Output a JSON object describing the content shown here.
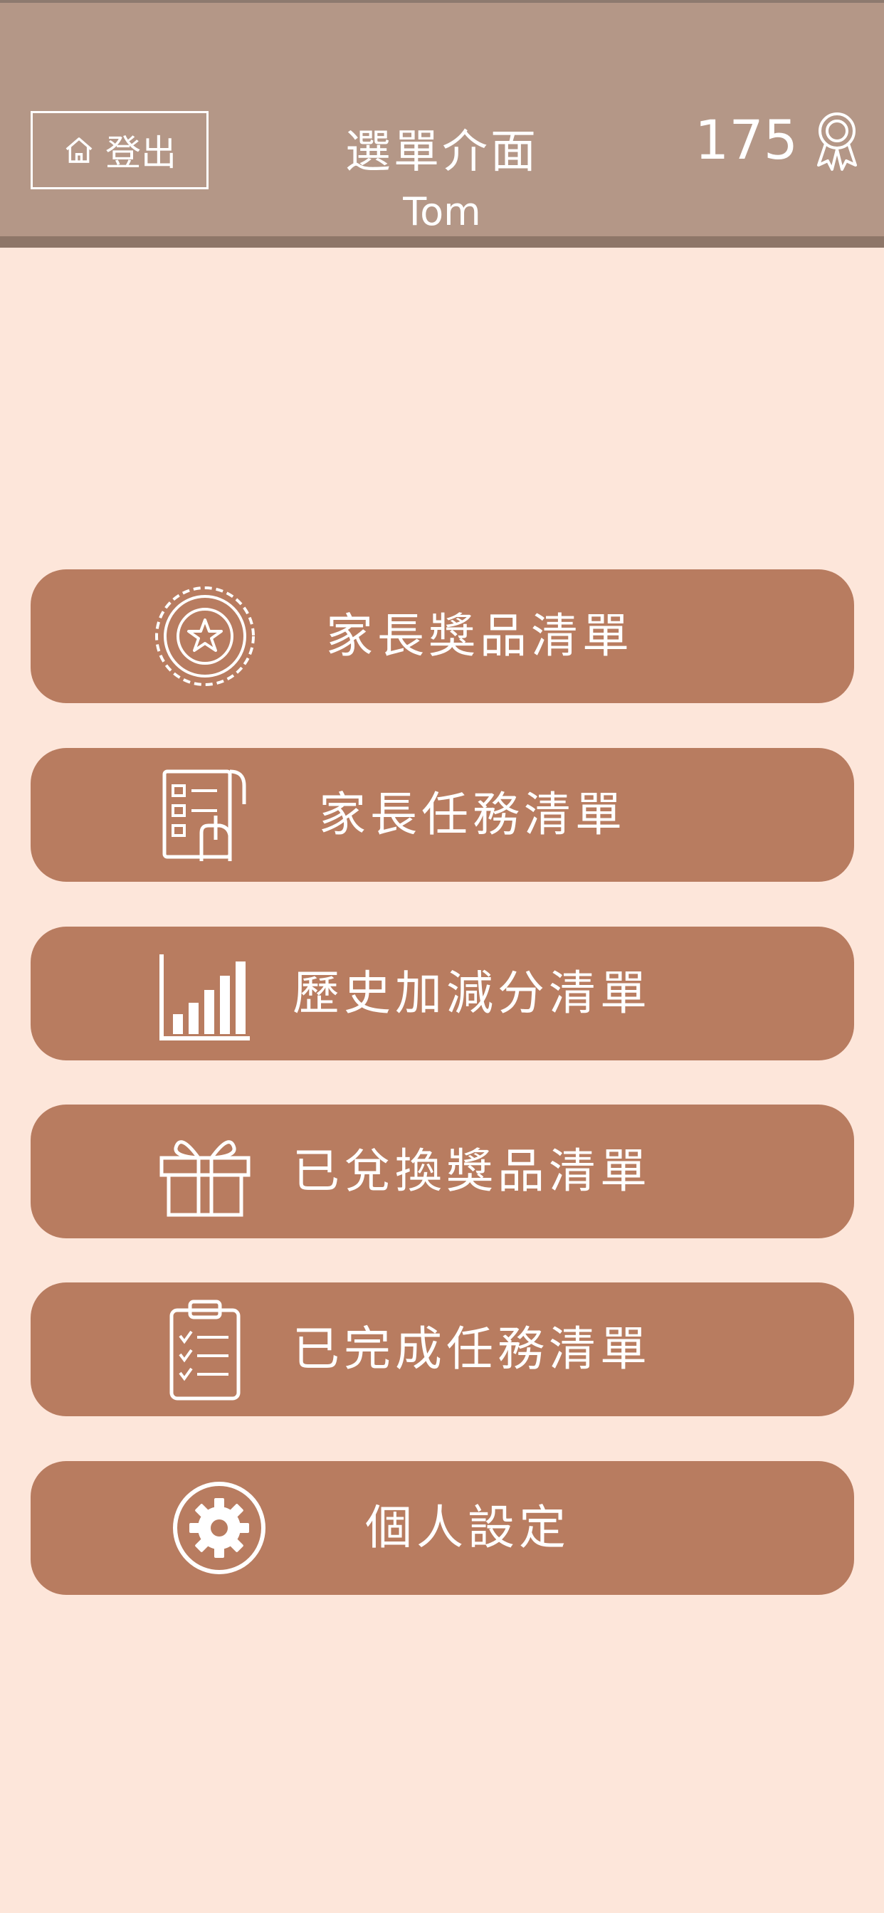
{
  "header": {
    "logout_label": "登出",
    "title": "選單介面",
    "user_name": "Tom",
    "points": "175"
  },
  "menu": {
    "items": [
      {
        "label": "家長獎品清單",
        "icon": "award-seal-icon"
      },
      {
        "label": "家長任務清單",
        "icon": "task-checklist-icon"
      },
      {
        "label": "歷史加減分清單",
        "icon": "bar-chart-icon"
      },
      {
        "label": "已兌換獎品清單",
        "icon": "gift-box-icon"
      },
      {
        "label": "已完成任務清單",
        "icon": "clipboard-check-icon"
      },
      {
        "label": "個人設定",
        "icon": "gear-icon"
      }
    ]
  },
  "colors": {
    "background": "#fde6da",
    "header": "#b49787",
    "button": "#b87c60",
    "text": "#ffffff"
  }
}
